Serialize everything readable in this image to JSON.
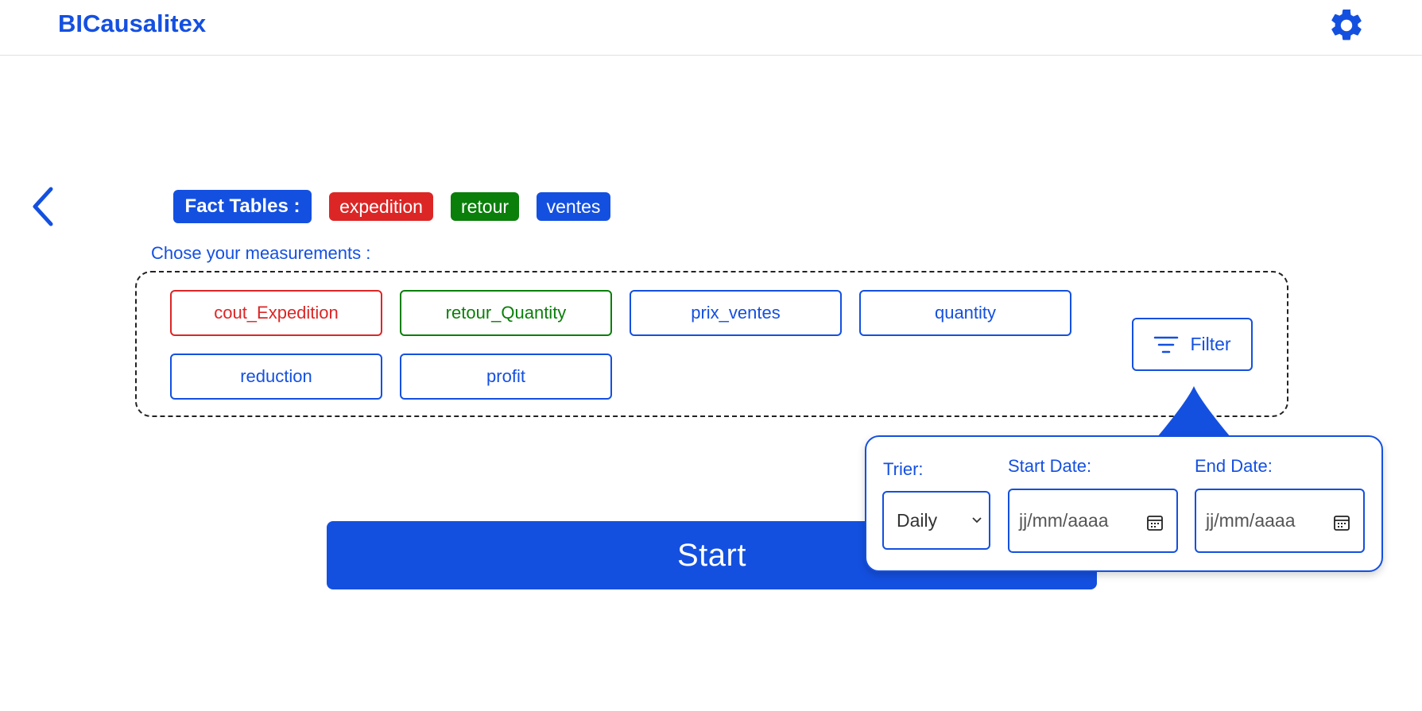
{
  "header": {
    "brand": "BICausalitex",
    "settings_icon": "gear-icon"
  },
  "navigation": {
    "back_icon": "chevron-left-icon"
  },
  "fact_tables": {
    "label": "Fact Tables :",
    "tables": [
      {
        "name": "expedition",
        "color": "#dc2626"
      },
      {
        "name": "retour",
        "color": "#0a7f0a"
      },
      {
        "name": "ventes",
        "color": "#1450e0"
      }
    ]
  },
  "measurements": {
    "prompt": "Chose your measurements :",
    "items": [
      {
        "label": "cout_Expedition",
        "color": "#dc2626"
      },
      {
        "label": "retour_Quantity",
        "color": "#0a7f0a"
      },
      {
        "label": "prix_ventes",
        "color": "#1450e0"
      },
      {
        "label": "quantity",
        "color": "#1450e0"
      },
      {
        "label": "reduction",
        "color": "#1450e0"
      },
      {
        "label": "profit",
        "color": "#1450e0"
      }
    ]
  },
  "filter": {
    "button_label": "Filter",
    "icon": "filter-icon",
    "popover": {
      "sort_label": "Trier:",
      "sort_value": "Daily",
      "start_label": "Start Date:",
      "start_placeholder": "jj/mm/aaaa",
      "end_label": "End Date:",
      "end_placeholder": "jj/mm/aaaa",
      "calendar_icon": "calendar-icon"
    }
  },
  "actions": {
    "start_label": "Start"
  },
  "colors": {
    "accent": "#1450e0",
    "red": "#dc2626",
    "green": "#0a7f0a"
  }
}
